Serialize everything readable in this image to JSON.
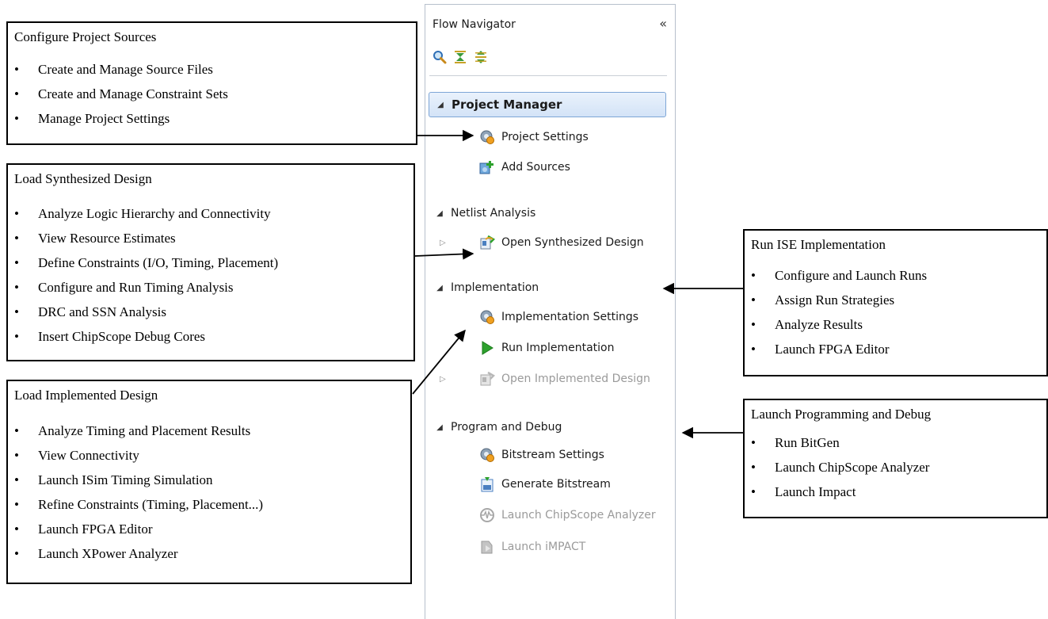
{
  "callouts": {
    "configure": {
      "title": "Configure Project Sources",
      "bullets": [
        "Create and Manage Source Files",
        "Create and Manage Constraint Sets",
        "Manage Project Settings"
      ]
    },
    "synth": {
      "title": "Load Synthesized Design",
      "bullets": [
        "Analyze Logic Hierarchy and Connectivity",
        "View Resource Estimates",
        "Define Constraints (I/O, Timing, Placement)",
        "Configure and Run Timing Analysis",
        "DRC and SSN Analysis",
        "Insert ChipScope Debug Cores"
      ]
    },
    "impl": {
      "title": "Load Implemented Design",
      "bullets": [
        "Analyze Timing and Placement Results",
        "View Connectivity",
        "Launch ISim Timing Simulation",
        "Refine Constraints (Timing, Placement...)",
        "Launch FPGA Editor",
        "Launch XPower Analyzer"
      ]
    },
    "ise": {
      "title": "Run ISE Implementation",
      "bullets": [
        "Configure and Launch Runs",
        "Assign Run Strategies",
        "Analyze Results",
        "Launch FPGA Editor"
      ]
    },
    "prog": {
      "title": "Launch Programming and Debug",
      "bullets": [
        "Run BitGen",
        "Launch ChipScope Analyzer",
        "Launch Impact"
      ]
    }
  },
  "navigator": {
    "title": "Flow Navigator",
    "collapse_glyph": "«",
    "sections": {
      "project_manager": "Project Manager",
      "netlist_analysis": "Netlist Analysis",
      "implementation": "Implementation",
      "program_debug": "Program and Debug"
    },
    "items": {
      "project_settings": "Project Settings",
      "add_sources": "Add Sources",
      "open_synth": "Open Synthesized Design",
      "impl_settings": "Implementation Settings",
      "run_impl": "Run Implementation",
      "open_impl": "Open Implemented Design",
      "bitstream_settings": "Bitstream Settings",
      "generate_bitstream": "Generate Bitstream",
      "launch_chipscope": "Launch ChipScope Analyzer",
      "launch_impact": "Launch iMPACT"
    },
    "icons": {
      "search": "search-icon",
      "collapse_all": "collapse-all-icon",
      "expand_all": "expand-all-icon",
      "settings": "gear-icon",
      "add": "add-sources-icon",
      "open_design": "open-design-icon",
      "run": "play-icon",
      "bitstream": "bitstream-icon",
      "chipscope": "chipscope-icon",
      "impact": "impact-icon"
    }
  },
  "colors": {
    "section_highlight": "#d3e3f7",
    "section_border": "#7ea6d6",
    "run_green": "#2da12d",
    "disabled_text": "#9a9a9a"
  }
}
